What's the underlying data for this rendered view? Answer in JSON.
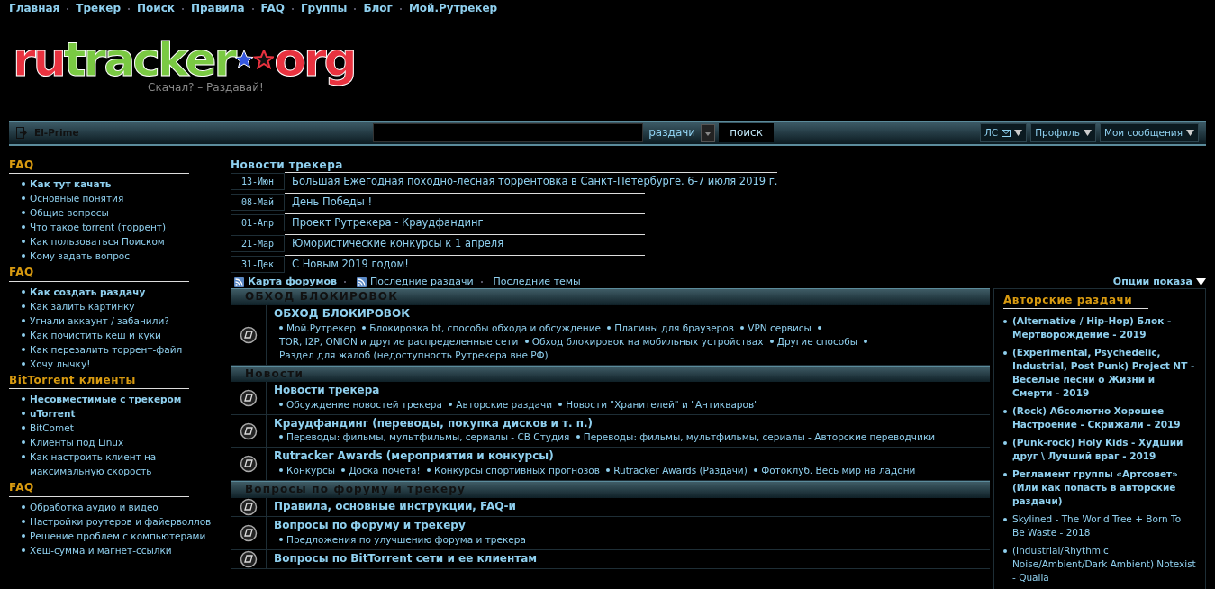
{
  "top_nav": [
    "Главная",
    "Трекер",
    "Поиск",
    "Правила",
    "FAQ",
    "Группы",
    "Блог",
    "Мой.Рутрекер"
  ],
  "logo": {
    "parts": [
      {
        "text": "ru",
        "color": "#e8323f"
      },
      {
        "text": "tracker",
        "color": "#7ac943"
      },
      {
        "text": "org",
        "color": "#e8323f"
      }
    ],
    "tagline": "Скачал? – Раздавай!"
  },
  "user_bar": {
    "username": "El-Prime",
    "search_scope": "раздачи",
    "search_button": "поиск",
    "menus": [
      {
        "label": "ЛС",
        "mail": true
      },
      {
        "label": "Профиль",
        "mail": false
      },
      {
        "label": "Мои сообщения",
        "mail": false
      }
    ]
  },
  "sidebar": [
    {
      "title": "FAQ",
      "items": [
        {
          "text": "Как тут качать",
          "emphasized": true
        },
        {
          "text": "Основные понятия",
          "emphasized": false
        },
        {
          "text": "Общие вопросы",
          "emphasized": false
        },
        {
          "text": "Что такое torrent (торрент)",
          "emphasized": false
        },
        {
          "text": "Как пользоваться Поиском",
          "emphasized": false
        },
        {
          "text": "Кому задать вопрос",
          "emphasized": false
        }
      ]
    },
    {
      "title": "FAQ",
      "items": [
        {
          "text": "Как создать раздачу",
          "emphasized": true
        },
        {
          "text": "Как залить картинку",
          "emphasized": false
        },
        {
          "text": "Угнали аккаунт / забанили?",
          "emphasized": false
        },
        {
          "text": "Как почистить кеш и куки",
          "emphasized": false
        },
        {
          "text": "Как перезалить торрент-файл",
          "emphasized": false
        },
        {
          "text": "Хочу лычку!",
          "emphasized": false
        }
      ]
    },
    {
      "title": "BitTorrent клиенты",
      "items": [
        {
          "text": "Несовместимые с трекером",
          "emphasized": true
        },
        {
          "text": "uTorrent",
          "emphasized": true
        },
        {
          "text": "BitComet",
          "emphasized": false
        },
        {
          "text": "Клиенты под Linux",
          "emphasized": false
        },
        {
          "text": "Как настроить клиент на максимальную скорость",
          "emphasized": false
        }
      ]
    },
    {
      "title": "FAQ",
      "items": [
        {
          "text": "Обработка аудио и видео",
          "emphasized": false
        },
        {
          "text": "Настройки роутеров и файерволлов",
          "emphasized": false
        },
        {
          "text": "Решение проблем с компьютерами",
          "emphasized": false
        },
        {
          "text": "Хеш-сумма и магнет-ссылки",
          "emphasized": false
        }
      ]
    }
  ],
  "news": {
    "title": "Новости трекера",
    "items": [
      {
        "date": "13-Июн",
        "text": "Большая Ежегодная походно-лесная торрентовка в Санкт-Петербурге. 6-7 июля 2019 г."
      },
      {
        "date": "08-Май",
        "text": "День Победы !"
      },
      {
        "date": "01-Апр",
        "text": "Проект Рутрекера - Краудфандинг"
      },
      {
        "date": "21-Мар",
        "text": "Юмористические конкурсы к 1 апреля"
      },
      {
        "date": "31-Дек",
        "text": "С Новым 2019 годом!"
      }
    ]
  },
  "links": [
    {
      "text": "Карта форумов",
      "rss": true,
      "emphasized": true
    },
    {
      "text": "Последние раздачи",
      "rss": true,
      "emphasized": false
    },
    {
      "text": "Последние темы",
      "rss": false,
      "emphasized": false
    }
  ],
  "display_options": "Опции показа",
  "categories": [
    {
      "title": "ОБХОД БЛОКИРОВОК",
      "forums": [
        {
          "title": "ОБХОД БЛОКИРОВОК",
          "subforums": [
            "Мой.Рутрекер",
            "Блокировка bt, способы обхода и обсуждение",
            "Плагины для браузеров",
            "VPN сервисы",
            "TOR, I2P, ONION и другие распределенные сети",
            "Обход блокировок на мобильных устройствах",
            "Другие способы",
            "Раздел для жалоб (недоступность Рутрекера вне РФ)"
          ]
        }
      ]
    },
    {
      "title": "Новости",
      "forums": [
        {
          "title": "Новости трекера",
          "subforums": [
            "Обсуждение новостей трекера",
            "Авторские раздачи",
            "Новости \"Хранителей\" и \"Антикваров\""
          ]
        },
        {
          "title": "Краудфандинг (переводы, покупка дисков и т. п.)",
          "subforums": [
            "Переводы: фильмы, мультфильмы, сериалы - СВ Студия",
            "Переводы: фильмы, мультфильмы, сериалы - Авторские переводчики"
          ]
        },
        {
          "title": "Rutracker Awards (мероприятия и конкурсы)",
          "subforums": [
            "Конкурсы",
            "Доска почета!",
            "Конкурсы спортивных прогнозов",
            "Rutracker Awards (Раздачи)",
            "Фотоклуб. Весь мир на ладони"
          ]
        }
      ]
    },
    {
      "title": "Вопросы по форуму и трекеру",
      "forums": [
        {
          "title": "Правила, основные инструкции, FAQ-и"
        },
        {
          "title": "Вопросы по форуму и трекеру",
          "subforums": [
            "Предложения по улучшению форума и трекера"
          ]
        },
        {
          "title": "Вопросы по BitTorrent сети и ее клиентам"
        }
      ]
    }
  ],
  "author_releases": {
    "title": "Авторские раздачи",
    "items": [
      {
        "text": "(Alternative / Hip-Hop) Блок - Мертворождение - 2019",
        "emphasized": true
      },
      {
        "text": "(Experimental, Psychedelic, Industrial, Post Punk) Project NT - Веселые песни о Жизни и Смерти - 2019",
        "emphasized": true
      },
      {
        "text": "(Rock) Абсолютно Хорошее Настроение - Скрижали - 2019",
        "emphasized": true
      },
      {
        "text": "(Punk-rock) Holy Kids - Худший друг \\ Лучший враг - 2019",
        "emphasized": true
      },
      {
        "text": "Регламент группы «Артсовет» (Или как попасть в авторские раздачи)",
        "emphasized": true
      },
      {
        "text": "Skylined - The World Tree + Born To Be Waste - 2018",
        "emphasized": false
      },
      {
        "text": "(Industrial/Rhythmic Noise/Ambient/Dark Ambient) Notexist - Qualia",
        "emphasized": false
      }
    ]
  }
}
